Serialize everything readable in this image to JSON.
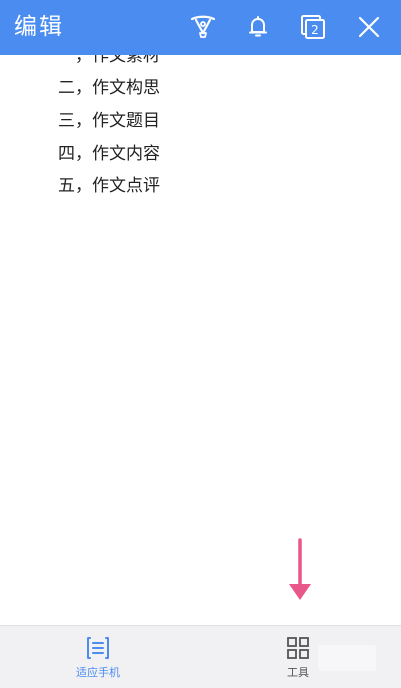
{
  "header": {
    "title": "编辑",
    "tabs_count": "2",
    "background_color": "#4a8cf0",
    "icons": [
      "highlighter-icon",
      "bell-icon",
      "tabs-icon",
      "close-icon"
    ]
  },
  "document": {
    "lines": [
      "一，作文素材",
      "二，作文构思",
      "三，作文题目",
      "四，作文内容",
      "五，作文点评"
    ]
  },
  "annotation": {
    "arrow_color": "#e8578a",
    "arrow_direction": "down"
  },
  "bottom_bar": {
    "fit_phone_label": "适应手机",
    "tools_label": "工具",
    "active_color": "#4a8cf0",
    "inactive_color": "#555555"
  }
}
